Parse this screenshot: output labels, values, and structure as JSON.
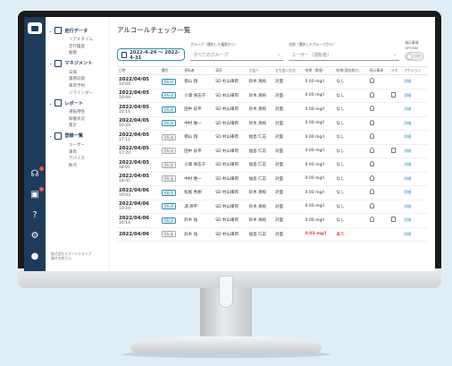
{
  "app": {
    "title": "アルコールチェック一覧",
    "company_line1": "株式会社スマートドライブ",
    "company_line2": "藤井太郎さん"
  },
  "sidebar": {
    "sections": [
      {
        "label": "走行データ",
        "icon": "chart-line-icon",
        "items": [
          "リアルタイム",
          "走行履歴",
          "動態"
        ]
      },
      {
        "label": "マネジメント",
        "icon": "clipboard-icon",
        "items": [
          "日報",
          "業務記録",
          "車両予約",
          "リマインダー"
        ]
      },
      {
        "label": "レポート",
        "icon": "bar-chart-icon",
        "items": [
          "運転特性",
          "稼働状況",
          "集計"
        ]
      },
      {
        "label": "登録一覧",
        "icon": "list-icon",
        "items": [
          "ユーザー",
          "車両",
          "デバイス",
          "拠点"
        ]
      }
    ]
  },
  "filters": {
    "date_range": "2022-4-24 〜 2022-4-31",
    "group_label": "グループ（選択した権限から）",
    "group_value": "すべてのグループ",
    "name_label": "名前（選択したグループから）",
    "name_value": "ユーザー（運転者）",
    "toggle_label": "指示事項 OFF/ON",
    "toggle_state": "OFF"
  },
  "table": {
    "headers": [
      "日時",
      "種別",
      "運転者",
      "車両",
      "立会人",
      "立ち会い方法",
      "結果（数値）",
      "結果(酒気帯び)",
      "指示事項",
      "メモ",
      "アクション"
    ],
    "rows": [
      {
        "date": "2022/04/05",
        "time": "10:04",
        "type": "運転前",
        "driver": "徳山 翔",
        "vehicle": "SD 杉山車両",
        "witness": "鈴木 清純",
        "method": "対面",
        "value": "0.00 mg/l",
        "verdict": "なし",
        "bulb": true,
        "memo": false,
        "action": "詳細",
        "warn": false,
        "type_style": "blue"
      },
      {
        "date": "2022/04/05",
        "time": "10:09",
        "type": "運転前",
        "driver": "小澤 保志子",
        "vehicle": "SD 村山車両",
        "witness": "鈴木 清純",
        "method": "対面",
        "value": "0.00 mg/l",
        "verdict": "なし",
        "bulb": true,
        "memo": true,
        "action": "詳細",
        "warn": false,
        "type_style": "blue"
      },
      {
        "date": "2022/04/05",
        "time": "10:14",
        "type": "運転前",
        "driver": "田中 紡平",
        "vehicle": "SD 村山車両",
        "witness": "鈴木 清純",
        "method": "対面",
        "value": "0.00 mg/l",
        "verdict": "なし",
        "bulb": true,
        "memo": false,
        "action": "詳細",
        "warn": false,
        "type_style": "blue"
      },
      {
        "date": "2022/04/05",
        "time": "10:20",
        "type": "運転前",
        "driver": "中村 唯一",
        "vehicle": "SD 村山車両",
        "witness": "鈴木 清純",
        "method": "対面",
        "value": "0.00 mg/l",
        "verdict": "なし",
        "bulb": true,
        "memo": false,
        "action": "詳細",
        "warn": false,
        "type_style": "blue"
      },
      {
        "date": "2022/04/05",
        "time": "17:12",
        "type": "運転後",
        "driver": "徳山 翔",
        "vehicle": "SD 村山車両",
        "witness": "福島 仁志",
        "method": "対面",
        "value": "0.00 mg/l",
        "verdict": "なし",
        "bulb": true,
        "memo": false,
        "action": "詳細",
        "warn": false,
        "type_style": "gray"
      },
      {
        "date": "2022/04/05",
        "time": "17:20",
        "type": "運転後",
        "driver": "田中 紡平",
        "vehicle": "SD 村山車両",
        "witness": "福島 仁志",
        "method": "対面",
        "value": "0.00 mg/l",
        "verdict": "なし",
        "bulb": true,
        "memo": true,
        "action": "詳細",
        "warn": false,
        "type_style": "gray"
      },
      {
        "date": "2022/04/05",
        "time": "18:01",
        "type": "運転後",
        "driver": "小澤 保志子",
        "vehicle": "SD 村山車両",
        "witness": "福島 仁志",
        "method": "対面",
        "value": "0.00 mg/l",
        "verdict": "なし",
        "bulb": true,
        "memo": false,
        "action": "詳細",
        "warn": false,
        "type_style": "gray"
      },
      {
        "date": "2022/04/05",
        "time": "18:45",
        "type": "運転後",
        "driver": "中村 唯一",
        "vehicle": "SD 村山車両",
        "witness": "福島 仁志",
        "method": "対面",
        "value": "0.00 mg/l",
        "verdict": "なし",
        "bulb": true,
        "memo": false,
        "action": "詳細",
        "warn": false,
        "type_style": "gray"
      },
      {
        "date": "2022/04/06",
        "time": "10:03",
        "type": "運転前",
        "driver": "松尾 秀樹",
        "vehicle": "SD 村山車両",
        "witness": "鈴木 清純",
        "method": "対面",
        "value": "0.00 mg/l",
        "verdict": "なし",
        "bulb": true,
        "memo": false,
        "action": "詳細",
        "warn": false,
        "type_style": "blue"
      },
      {
        "date": "2022/04/06",
        "time": "10:10",
        "type": "運転前",
        "driver": "湯 修平",
        "vehicle": "SD 村山車両",
        "witness": "鈴木 清純",
        "method": "対面",
        "value": "0.00 mg/l",
        "verdict": "なし",
        "bulb": true,
        "memo": false,
        "action": "詳細",
        "warn": false,
        "type_style": "blue"
      },
      {
        "date": "2022/04/06",
        "time": "10:14",
        "type": "運転前",
        "driver": "鈴木 祐",
        "vehicle": "SD 村山車両",
        "witness": "鈴木 清純",
        "method": "対面",
        "value": "0.00 mg/l",
        "verdict": "なし",
        "bulb": true,
        "memo": true,
        "action": "詳細",
        "warn": false,
        "type_style": "blue"
      },
      {
        "date": "2022/04/06",
        "time": "",
        "type": "運転後",
        "driver": "鈴木 祐",
        "vehicle": "SD 村山車両",
        "witness": "福島 仁志",
        "method": "対面",
        "value": "0.03 mg/l",
        "verdict": "あり",
        "bulb": false,
        "memo": false,
        "action": "詳細",
        "warn": true,
        "type_style": "gray"
      }
    ]
  },
  "colors": {
    "rail": "#1d3c5c",
    "accent": "#2a8fb0",
    "warning": "#e03e3e"
  }
}
